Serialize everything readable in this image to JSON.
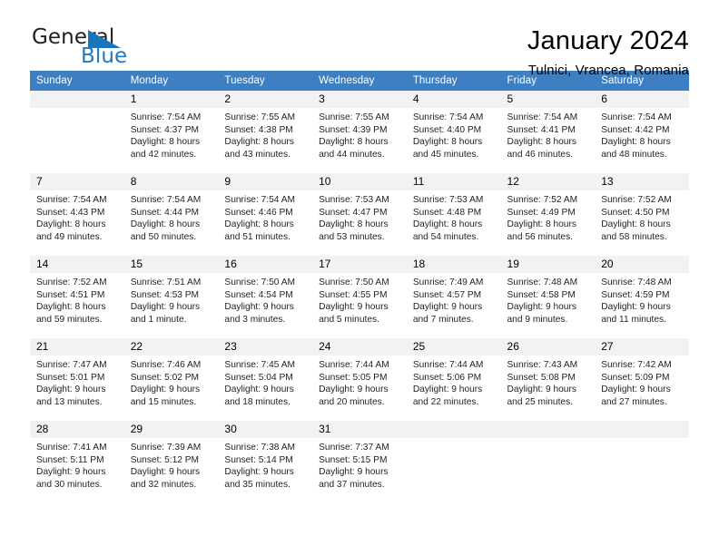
{
  "brand": {
    "name_part1": "General",
    "name_part2": "Blue",
    "accent_color": "#1b75bb"
  },
  "header": {
    "title": "January 2024",
    "subtitle": "Tulnici, Vrancea, Romania"
  },
  "calendar": {
    "header_bg": "#3d7fc1",
    "daynum_bg": "#f2f2f2",
    "weekdays": [
      "Sunday",
      "Monday",
      "Tuesday",
      "Wednesday",
      "Thursday",
      "Friday",
      "Saturday"
    ],
    "weeks": [
      [
        {
          "day": "",
          "sunrise": "",
          "sunset": "",
          "daylight1": "",
          "daylight2": "",
          "empty": true
        },
        {
          "day": "1",
          "sunrise": "Sunrise: 7:54 AM",
          "sunset": "Sunset: 4:37 PM",
          "daylight1": "Daylight: 8 hours",
          "daylight2": "and 42 minutes."
        },
        {
          "day": "2",
          "sunrise": "Sunrise: 7:55 AM",
          "sunset": "Sunset: 4:38 PM",
          "daylight1": "Daylight: 8 hours",
          "daylight2": "and 43 minutes."
        },
        {
          "day": "3",
          "sunrise": "Sunrise: 7:55 AM",
          "sunset": "Sunset: 4:39 PM",
          "daylight1": "Daylight: 8 hours",
          "daylight2": "and 44 minutes."
        },
        {
          "day": "4",
          "sunrise": "Sunrise: 7:54 AM",
          "sunset": "Sunset: 4:40 PM",
          "daylight1": "Daylight: 8 hours",
          "daylight2": "and 45 minutes."
        },
        {
          "day": "5",
          "sunrise": "Sunrise: 7:54 AM",
          "sunset": "Sunset: 4:41 PM",
          "daylight1": "Daylight: 8 hours",
          "daylight2": "and 46 minutes."
        },
        {
          "day": "6",
          "sunrise": "Sunrise: 7:54 AM",
          "sunset": "Sunset: 4:42 PM",
          "daylight1": "Daylight: 8 hours",
          "daylight2": "and 48 minutes."
        }
      ],
      [
        {
          "day": "7",
          "sunrise": "Sunrise: 7:54 AM",
          "sunset": "Sunset: 4:43 PM",
          "daylight1": "Daylight: 8 hours",
          "daylight2": "and 49 minutes."
        },
        {
          "day": "8",
          "sunrise": "Sunrise: 7:54 AM",
          "sunset": "Sunset: 4:44 PM",
          "daylight1": "Daylight: 8 hours",
          "daylight2": "and 50 minutes."
        },
        {
          "day": "9",
          "sunrise": "Sunrise: 7:54 AM",
          "sunset": "Sunset: 4:46 PM",
          "daylight1": "Daylight: 8 hours",
          "daylight2": "and 51 minutes."
        },
        {
          "day": "10",
          "sunrise": "Sunrise: 7:53 AM",
          "sunset": "Sunset: 4:47 PM",
          "daylight1": "Daylight: 8 hours",
          "daylight2": "and 53 minutes."
        },
        {
          "day": "11",
          "sunrise": "Sunrise: 7:53 AM",
          "sunset": "Sunset: 4:48 PM",
          "daylight1": "Daylight: 8 hours",
          "daylight2": "and 54 minutes."
        },
        {
          "day": "12",
          "sunrise": "Sunrise: 7:52 AM",
          "sunset": "Sunset: 4:49 PM",
          "daylight1": "Daylight: 8 hours",
          "daylight2": "and 56 minutes."
        },
        {
          "day": "13",
          "sunrise": "Sunrise: 7:52 AM",
          "sunset": "Sunset: 4:50 PM",
          "daylight1": "Daylight: 8 hours",
          "daylight2": "and 58 minutes."
        }
      ],
      [
        {
          "day": "14",
          "sunrise": "Sunrise: 7:52 AM",
          "sunset": "Sunset: 4:51 PM",
          "daylight1": "Daylight: 8 hours",
          "daylight2": "and 59 minutes."
        },
        {
          "day": "15",
          "sunrise": "Sunrise: 7:51 AM",
          "sunset": "Sunset: 4:53 PM",
          "daylight1": "Daylight: 9 hours",
          "daylight2": "and 1 minute."
        },
        {
          "day": "16",
          "sunrise": "Sunrise: 7:50 AM",
          "sunset": "Sunset: 4:54 PM",
          "daylight1": "Daylight: 9 hours",
          "daylight2": "and 3 minutes."
        },
        {
          "day": "17",
          "sunrise": "Sunrise: 7:50 AM",
          "sunset": "Sunset: 4:55 PM",
          "daylight1": "Daylight: 9 hours",
          "daylight2": "and 5 minutes."
        },
        {
          "day": "18",
          "sunrise": "Sunrise: 7:49 AM",
          "sunset": "Sunset: 4:57 PM",
          "daylight1": "Daylight: 9 hours",
          "daylight2": "and 7 minutes."
        },
        {
          "day": "19",
          "sunrise": "Sunrise: 7:48 AM",
          "sunset": "Sunset: 4:58 PM",
          "daylight1": "Daylight: 9 hours",
          "daylight2": "and 9 minutes."
        },
        {
          "day": "20",
          "sunrise": "Sunrise: 7:48 AM",
          "sunset": "Sunset: 4:59 PM",
          "daylight1": "Daylight: 9 hours",
          "daylight2": "and 11 minutes."
        }
      ],
      [
        {
          "day": "21",
          "sunrise": "Sunrise: 7:47 AM",
          "sunset": "Sunset: 5:01 PM",
          "daylight1": "Daylight: 9 hours",
          "daylight2": "and 13 minutes."
        },
        {
          "day": "22",
          "sunrise": "Sunrise: 7:46 AM",
          "sunset": "Sunset: 5:02 PM",
          "daylight1": "Daylight: 9 hours",
          "daylight2": "and 15 minutes."
        },
        {
          "day": "23",
          "sunrise": "Sunrise: 7:45 AM",
          "sunset": "Sunset: 5:04 PM",
          "daylight1": "Daylight: 9 hours",
          "daylight2": "and 18 minutes."
        },
        {
          "day": "24",
          "sunrise": "Sunrise: 7:44 AM",
          "sunset": "Sunset: 5:05 PM",
          "daylight1": "Daylight: 9 hours",
          "daylight2": "and 20 minutes."
        },
        {
          "day": "25",
          "sunrise": "Sunrise: 7:44 AM",
          "sunset": "Sunset: 5:06 PM",
          "daylight1": "Daylight: 9 hours",
          "daylight2": "and 22 minutes."
        },
        {
          "day": "26",
          "sunrise": "Sunrise: 7:43 AM",
          "sunset": "Sunset: 5:08 PM",
          "daylight1": "Daylight: 9 hours",
          "daylight2": "and 25 minutes."
        },
        {
          "day": "27",
          "sunrise": "Sunrise: 7:42 AM",
          "sunset": "Sunset: 5:09 PM",
          "daylight1": "Daylight: 9 hours",
          "daylight2": "and 27 minutes."
        }
      ],
      [
        {
          "day": "28",
          "sunrise": "Sunrise: 7:41 AM",
          "sunset": "Sunset: 5:11 PM",
          "daylight1": "Daylight: 9 hours",
          "daylight2": "and 30 minutes."
        },
        {
          "day": "29",
          "sunrise": "Sunrise: 7:39 AM",
          "sunset": "Sunset: 5:12 PM",
          "daylight1": "Daylight: 9 hours",
          "daylight2": "and 32 minutes."
        },
        {
          "day": "30",
          "sunrise": "Sunrise: 7:38 AM",
          "sunset": "Sunset: 5:14 PM",
          "daylight1": "Daylight: 9 hours",
          "daylight2": "and 35 minutes."
        },
        {
          "day": "31",
          "sunrise": "Sunrise: 7:37 AM",
          "sunset": "Sunset: 5:15 PM",
          "daylight1": "Daylight: 9 hours",
          "daylight2": "and 37 minutes."
        },
        {
          "day": "",
          "sunrise": "",
          "sunset": "",
          "daylight1": "",
          "daylight2": "",
          "empty": true
        },
        {
          "day": "",
          "sunrise": "",
          "sunset": "",
          "daylight1": "",
          "daylight2": "",
          "empty": true
        },
        {
          "day": "",
          "sunrise": "",
          "sunset": "",
          "daylight1": "",
          "daylight2": "",
          "empty": true
        }
      ]
    ]
  }
}
